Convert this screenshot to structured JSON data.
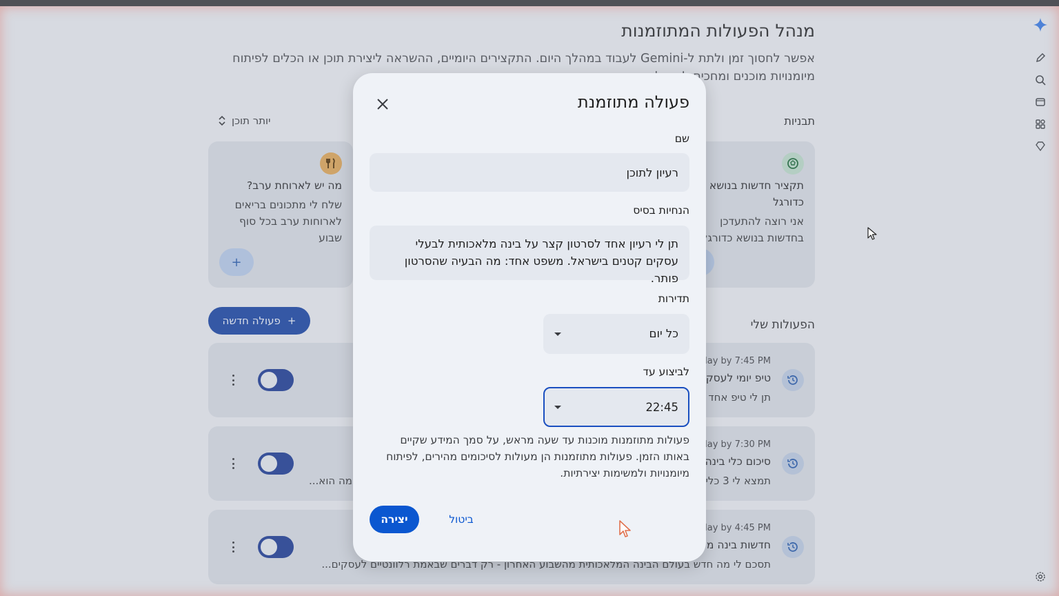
{
  "page": {
    "title": "מנהל הפעולות המתוזמנות",
    "subtitle": "אפשר לחסוך זמן ולתת ל-Gemini לעבוד במהלך היום. התקצירים היומיים, ההשראה ליצירת תוכן או הכלים לפיתוח מיומנויות מוכנים ומחכים לך בצ'א",
    "templates_label": "תבניות",
    "more_content_label": "יותר תוכן",
    "my_actions_label": "הפעולות שלי",
    "new_action_label": "פעולה חדשה"
  },
  "templates": [
    {
      "title": "תקציר חדשות בנושא כדורגל",
      "desc": "אני רוצה להתעדכן בחדשות בנושא כדורגל בינלאומי",
      "icon": "soccer-ball-icon"
    },
    {
      "title": "מה יש לארוחת ערב?",
      "desc": "שלח לי מתכונים בריאים לארוחות ערב בכל סוף שבוע",
      "icon": "utensils-icon"
    }
  ],
  "actions": [
    {
      "time": "day by 7:45 PM",
      "title": "טיפ יומי לעסק",
      "desc": "תן לי טיפ אחד"
    },
    {
      "time": "day by 7:30 PM",
      "title": "סיכום כלי בינה",
      "desc": "תמצא לי 3 כלי",
      "desc_tail": ": מה הוא..."
    },
    {
      "time": "day by 4:45 PM",
      "title": "חדשות בינה מ",
      "desc": "תסכם לי מה חדש בעולם הבינה המלאכותית מהשבוע האחרון - רק דברים שבאמת רלוונטיים לעסקים..."
    }
  ],
  "dialog": {
    "title": "פעולה מתוזמנת",
    "name_label": "שם",
    "name_value": "רעיון לתוכן",
    "instructions_label": "הנחיות בסיס",
    "instructions_value": "תן לי רעיון אחד לסרטון קצר על בינה מלאכותית לבעלי עסקים קטנים בישראל. משפט אחד: מה הבעיה שהסרטון פותר.",
    "frequency_label": "תדירות",
    "frequency_value": "כל יום",
    "deadline_label": "לביצוע עד",
    "deadline_value": "22:45",
    "note": "פעולות מתוזמנות מוכנות עד שעה מראש, על סמך המידע שקיים באותו הזמן. פעולות מתוזמנות הן מעולות לסיכומים מהירים, לפיתוח מיומנויות ולמשימות יצירתיות.",
    "create_label": "יצירה",
    "cancel_label": "ביטול"
  },
  "colors": {
    "primary": "#0b57d0",
    "toggle_on": "#213f94",
    "dialog_bg": "#eff2f7"
  }
}
